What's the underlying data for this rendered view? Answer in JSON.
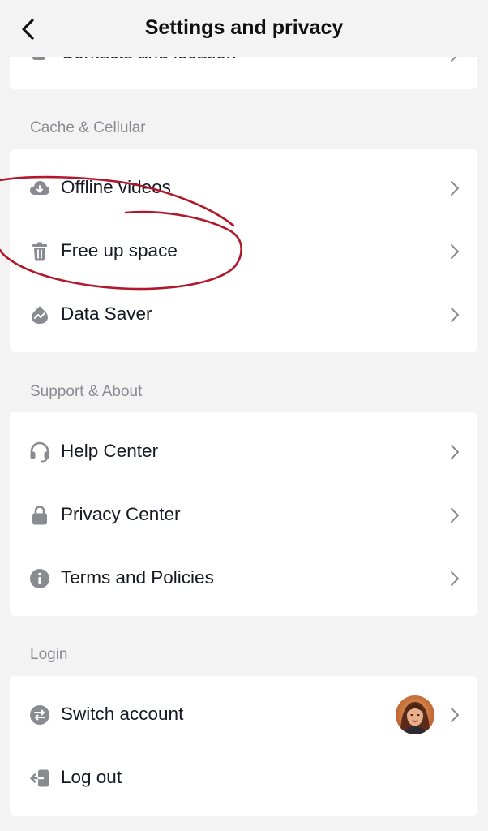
{
  "header": {
    "title": "Settings and privacy"
  },
  "top_card": {
    "partial_label": "Contacts and location"
  },
  "sections": {
    "cache": {
      "label": "Cache & Cellular",
      "items": [
        {
          "label": "Offline videos",
          "icon": "cloud-download-icon"
        },
        {
          "label": "Free up space",
          "icon": "trash-icon"
        },
        {
          "label": "Data Saver",
          "icon": "data-saver-icon"
        }
      ]
    },
    "support": {
      "label": "Support & About",
      "items": [
        {
          "label": "Help Center",
          "icon": "headset-icon"
        },
        {
          "label": "Privacy Center",
          "icon": "lock-icon"
        },
        {
          "label": "Terms and Policies",
          "icon": "info-icon"
        }
      ]
    },
    "login": {
      "label": "Login",
      "items": [
        {
          "label": "Switch account",
          "icon": "switch-icon"
        },
        {
          "label": "Log out",
          "icon": "logout-icon"
        }
      ]
    }
  },
  "colors": {
    "background": "#f3f3f3",
    "card": "#ffffff",
    "icon": "#8a8b91",
    "section_label": "#8a8b91",
    "annotation": "#b2182b"
  }
}
